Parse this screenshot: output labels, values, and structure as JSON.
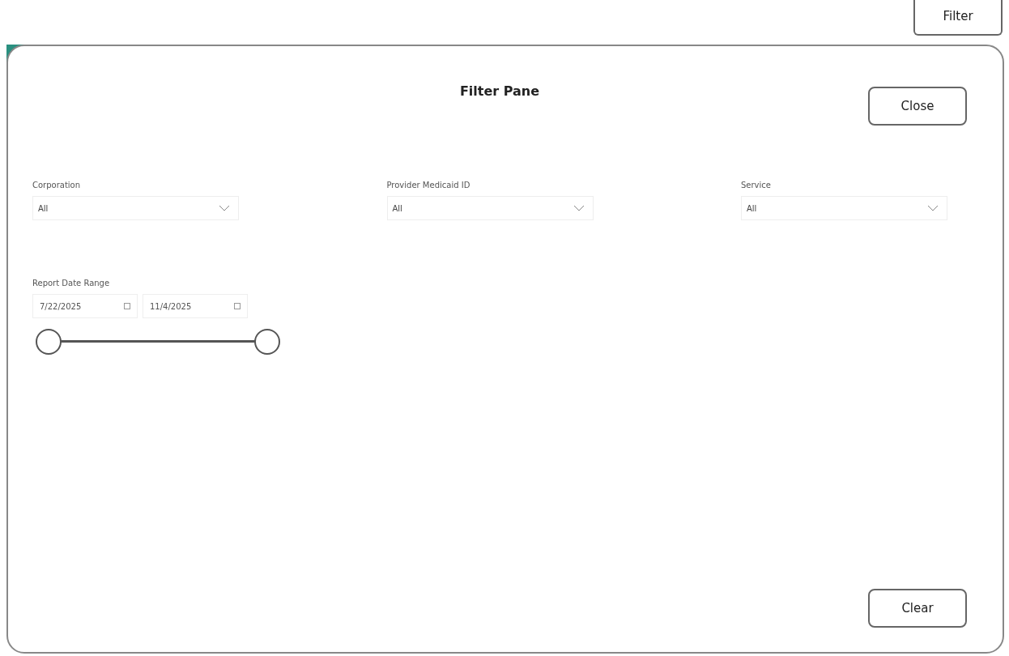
{
  "top_bar": {
    "filter_button": "Filter"
  },
  "pane": {
    "title": "Filter Pane",
    "close_button": "Close",
    "dropdowns": [
      {
        "label": "Corporation",
        "value": "All"
      },
      {
        "label": "Provider Medicaid ID",
        "value": "All"
      },
      {
        "label": "Service",
        "value": "All"
      }
    ],
    "date_range": {
      "label": "Report Date Range",
      "start": "7/22/2025",
      "end": "11/4/2025",
      "level": 1
    },
    "clear_button": "Clear"
  }
}
